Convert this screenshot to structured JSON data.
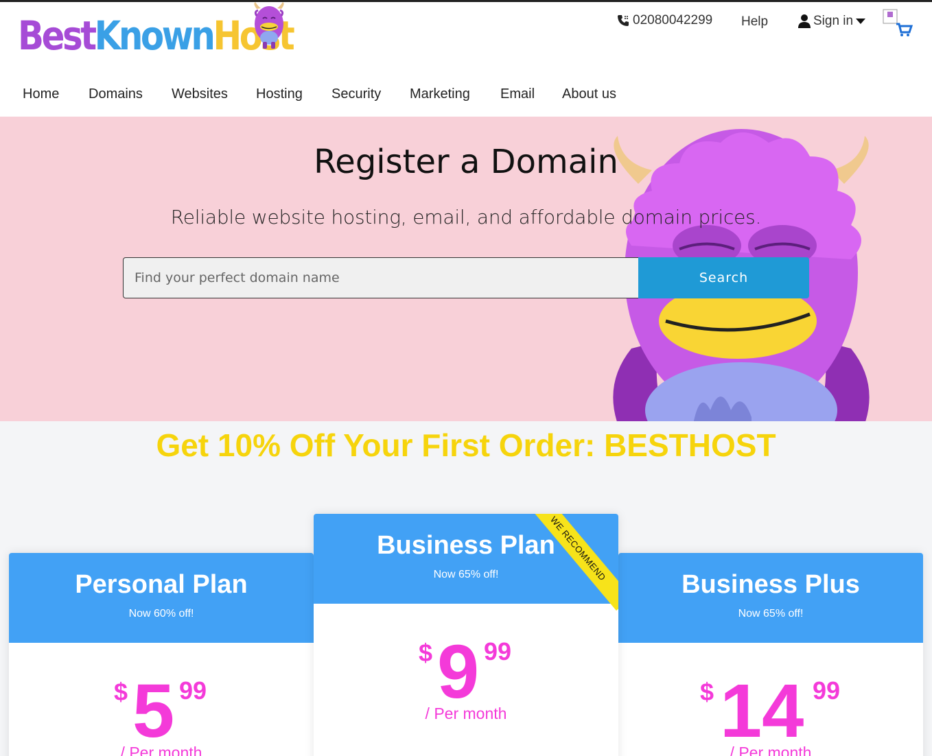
{
  "brand": {
    "logo_best": "Best",
    "logo_known": "Known",
    "logo_host": "Host",
    "colors": {
      "purple": "#a64bd6",
      "blue": "#3aa0e6",
      "yellow": "#f6c531"
    }
  },
  "header": {
    "phone": "02080042299",
    "help": "Help",
    "signin": "Sign in",
    "icons": {
      "phone": "phone-icon",
      "user": "user-icon",
      "dropdown": "chevron-down-icon",
      "cart": "cart-icon"
    }
  },
  "nav": {
    "items": [
      "Home",
      "Domains",
      "Websites",
      "Hosting",
      "Security",
      "Marketing",
      "Email",
      "About us"
    ]
  },
  "hero": {
    "title": "Register a Domain",
    "subtitle": "Reliable website hosting, email, and affordable domain prices.",
    "search_placeholder": "Find your perfect domain name",
    "search_value": "",
    "search_button": "Search",
    "background": "#f8d0d8",
    "button_color": "#1f9ad6"
  },
  "promo": {
    "text": "Get 10% Off Your First Order: BESTHOST",
    "color": "#f6d40c"
  },
  "plans": [
    {
      "name": "Personal Plan",
      "discount": "Now 60% off!",
      "currency": "$",
      "dollars": "5",
      "cents": "99",
      "period": "/ Per month"
    },
    {
      "name": "Business Plan",
      "discount": "Now 65% off!",
      "currency": "$",
      "dollars": "9",
      "cents": "99",
      "period": "/ Per month",
      "ribbon": "WE RECOMMEND"
    },
    {
      "name": "Business Plus",
      "discount": "Now 65% off!",
      "currency": "$",
      "dollars": "14",
      "cents": "99",
      "period": "/ Per month"
    }
  ],
  "plan_colors": {
    "header": "#42a1f5",
    "price": "#f43ad9",
    "ribbon": "#f7e31a"
  }
}
